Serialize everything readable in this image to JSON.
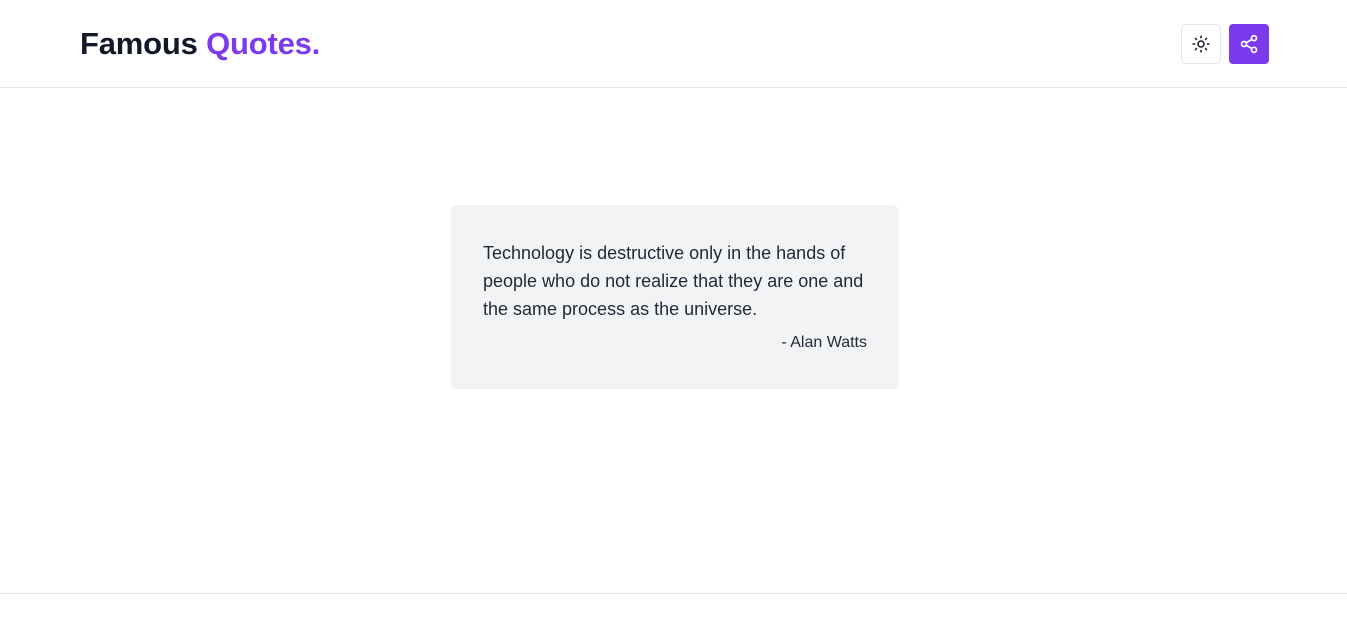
{
  "header": {
    "brand_main": "Famous",
    "brand_accent": "Quotes.",
    "theme_button_icon": "sun-icon",
    "share_button_icon": "share-icon"
  },
  "quote": {
    "text": "Technology is destructive only in the hands of people who do not realize that they are one and the same process as the universe.",
    "author": "- Alan Watts"
  },
  "colors": {
    "accent": "#7c3aed",
    "card_background": "#f2f3f5",
    "divider": "#e5e7eb"
  }
}
